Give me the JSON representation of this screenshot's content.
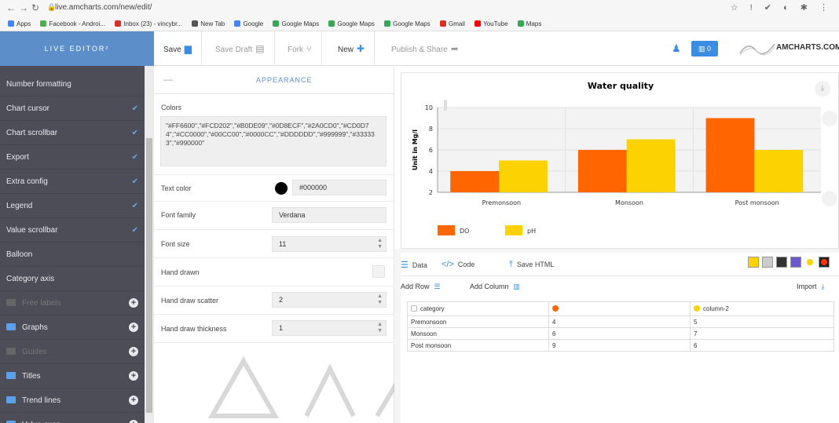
{
  "browser": {
    "url": "live.amcharts.com/new/edit/",
    "bookmarks": [
      "Apps",
      "Facebook - Androi...",
      "Inbox (23) - vincybr...",
      "New Tab",
      "Google",
      "Google Maps",
      "Google Maps",
      "Google Maps",
      "Gmail",
      "YouTube",
      "Maps"
    ]
  },
  "toolbar": {
    "brand": "LIVE EDITOR²",
    "save": "Save",
    "save_draft": "Save Draft",
    "fork": "Fork",
    "new": "New",
    "publish": "Publish & Share",
    "badge": "0",
    "logo": "AMCHARTS.COM"
  },
  "sidebar": {
    "items": [
      {
        "label": "Number formatting",
        "check": false
      },
      {
        "label": "Chart cursor",
        "check": true
      },
      {
        "label": "Chart scrollbar",
        "check": true
      },
      {
        "label": "Export",
        "check": true
      },
      {
        "label": "Extra config",
        "check": true
      },
      {
        "label": "Legend",
        "check": true
      },
      {
        "label": "Value scrollbar",
        "check": true
      },
      {
        "label": "Balloon",
        "check": false
      },
      {
        "label": "Category axis",
        "check": false
      }
    ],
    "folders": [
      {
        "label": "Free labels",
        "dim": true
      },
      {
        "label": "Graphs",
        "dim": false
      },
      {
        "label": "Guides",
        "dim": true
      },
      {
        "label": "Titles",
        "dim": false
      },
      {
        "label": "Trend lines",
        "dim": false
      },
      {
        "label": "Value axes",
        "dim": false
      }
    ]
  },
  "panel": {
    "title": "APPEARANCE",
    "colors_label": "Colors",
    "colors_value": "\"#FF6600\",\"#FCD202\",\"#B0DE09\",\"#0D8ECF\",\"#2A0CD0\",\"#CD0D74\",\"#CC0000\",\"#00CC00\",\"#0000CC\",\"#DDDDDD\",\"#999999\",\"#333333\",\"#990000\"",
    "text_color_label": "Text color",
    "text_color_value": "#000000",
    "font_family_label": "Font family",
    "font_family_value": "Verdana",
    "font_size_label": "Font size",
    "font_size_value": "11",
    "hand_drawn_label": "Hand drawn",
    "hand_drawn_checked": false,
    "hand_draw_scatter_label": "Hand draw scatter",
    "hand_draw_scatter_value": "2",
    "hand_draw_thickness_label": "Hand draw thickness",
    "hand_draw_thickness_value": "1"
  },
  "chart_data": {
    "type": "bar",
    "title": "Water quality",
    "ylabel": "Unit in Mg/l",
    "xlabel": "",
    "categories": [
      "Premonsoon",
      "Monsoon",
      "Post monsoon"
    ],
    "series": [
      {
        "name": "DO",
        "color": "#FF6600",
        "values": [
          4,
          6,
          9
        ]
      },
      {
        "name": "pH",
        "color": "#FCD202",
        "values": [
          5,
          7,
          6
        ]
      }
    ],
    "ylim": [
      2,
      10
    ],
    "yticks": [
      2,
      4,
      6,
      8,
      10
    ],
    "grid": true,
    "legend": "bottom"
  },
  "bottom": {
    "tab_data": "Data",
    "tab_code": "Code",
    "tab_save_html": "Save HTML",
    "add_row": "Add Row",
    "add_column": "Add Column",
    "import": "Import",
    "table_header": [
      "category",
      "",
      "column-2"
    ],
    "table_rows": [
      [
        "Premonsoon",
        "4",
        "5"
      ],
      [
        "Monsoon",
        "6",
        "7"
      ],
      [
        "Post monsoon",
        "9",
        "6"
      ]
    ]
  }
}
